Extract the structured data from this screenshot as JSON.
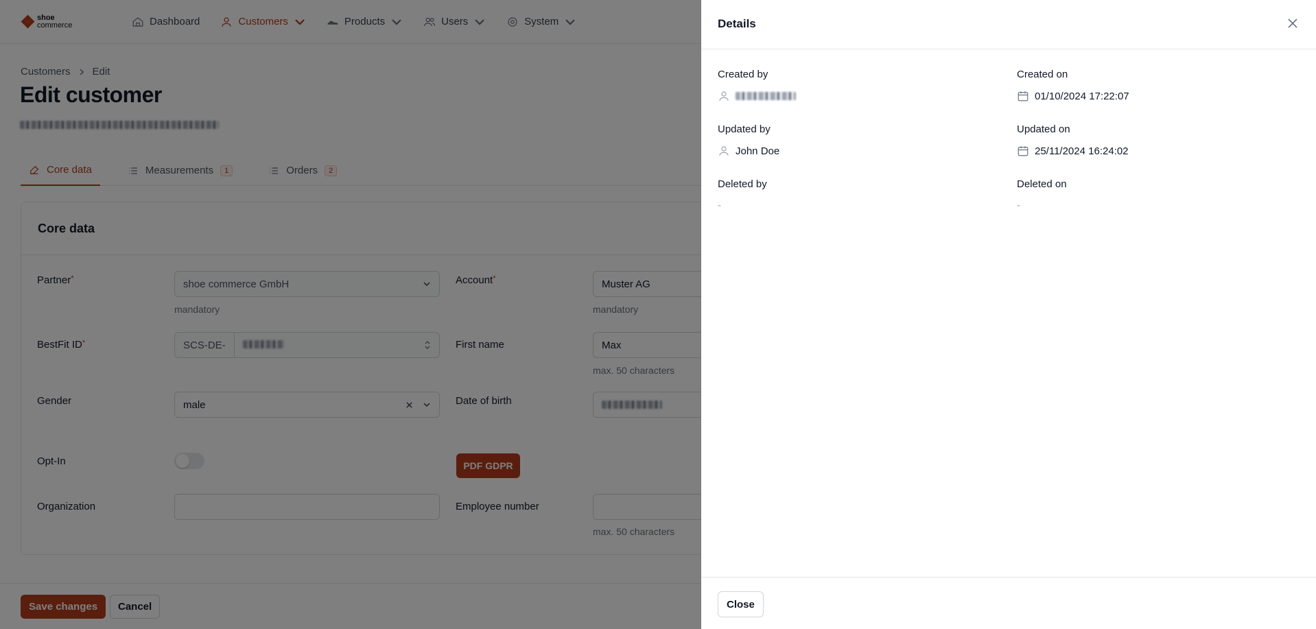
{
  "brand": {
    "line1": "shoe",
    "line2": "commerce"
  },
  "nav": {
    "dashboard": "Dashboard",
    "customers": "Customers",
    "products": "Products",
    "users": "Users",
    "system": "System"
  },
  "breadcrumb": {
    "root": "Customers",
    "current": "Edit"
  },
  "page": {
    "title": "Edit customer"
  },
  "tabs": [
    {
      "label": "Core data"
    },
    {
      "label": "Measurements",
      "count": "1"
    },
    {
      "label": "Orders",
      "count": "2"
    }
  ],
  "core": {
    "title": "Core data",
    "partner_label": "Partner",
    "partner_value": "shoe commerce GmbH",
    "partner_hint": "mandatory",
    "account_label": "Account",
    "account_value": "Muster AG",
    "account_hint": "mandatory",
    "bestfit_label": "BestFit ID",
    "bestfit_prefix": "SCS-DE-",
    "firstname_label": "First name",
    "firstname_value": "Max",
    "firstname_hint": "max. 50 characters",
    "gender_label": "Gender",
    "gender_value": "male",
    "dob_label": "Date of birth",
    "optin_label": "Opt-In",
    "pdf_button": "PDF GDPR",
    "org_label": "Organization",
    "employee_label": "Employee number",
    "employee_hint": "max. 50 characters"
  },
  "footer": {
    "save": "Save changes",
    "cancel": "Cancel"
  },
  "drawer": {
    "title": "Details",
    "created_by_label": "Created by",
    "created_on_label": "Created on",
    "created_on_value": "01/10/2024 17:22:07",
    "updated_by_label": "Updated by",
    "updated_by_value": "John Doe",
    "updated_on_label": "Updated on",
    "updated_on_value": "25/11/2024 16:24:02",
    "deleted_by_label": "Deleted by",
    "deleted_by_value": "-",
    "deleted_on_label": "Deleted on",
    "deleted_on_value": "-",
    "close_button": "Close"
  },
  "colors": {
    "accent": "#b43c1c",
    "overlay": "rgba(0,0,0,0.5)"
  }
}
